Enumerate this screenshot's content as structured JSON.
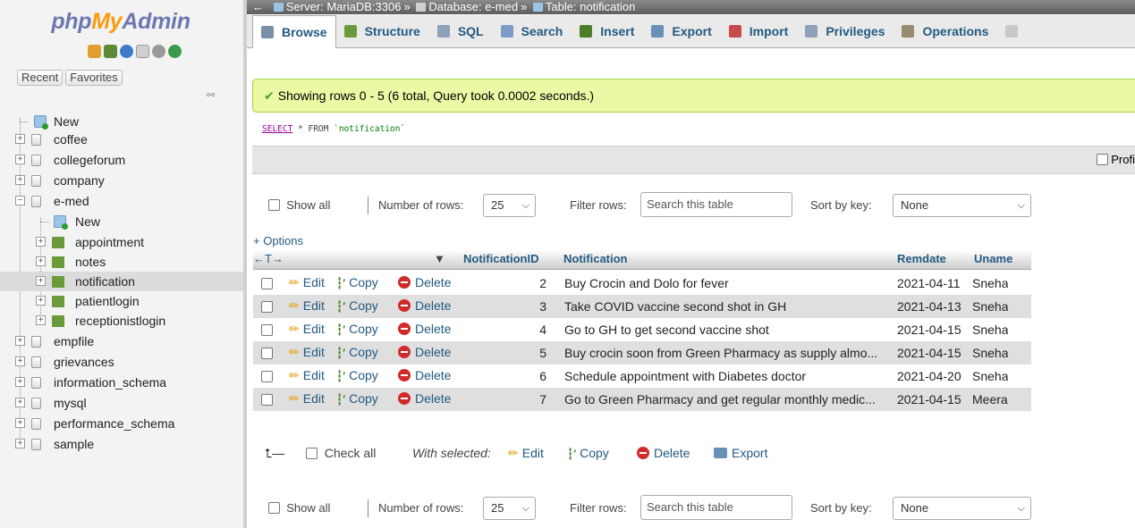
{
  "app": {
    "logo_php": "php",
    "logo_my": "My",
    "logo_admin": "Admin"
  },
  "nav": {
    "recent_tab": "Recent",
    "favorites_tab": "Favorites",
    "new_label": "New",
    "databases": [
      {
        "label": "coffee"
      },
      {
        "label": "collegeforum"
      },
      {
        "label": "company"
      },
      {
        "label": "e-med"
      },
      {
        "label": "empfile"
      },
      {
        "label": "grievances"
      },
      {
        "label": "information_schema"
      },
      {
        "label": "mysql"
      },
      {
        "label": "performance_schema"
      },
      {
        "label": "sample"
      }
    ],
    "emed_new": "New",
    "emed_tables": [
      {
        "label": "appointment"
      },
      {
        "label": "notes"
      },
      {
        "label": "notification"
      },
      {
        "label": "patientlogin"
      },
      {
        "label": "receptionistlogin"
      }
    ]
  },
  "breadcrumb": {
    "back": "←",
    "server": "Server: MariaDB:3306",
    "database": "Database: e-med",
    "table": "Table: notification",
    "sep": "»"
  },
  "tabs": [
    {
      "label": "Browse",
      "icon": "browse-icon",
      "color": "#7a8fa8"
    },
    {
      "label": "Structure",
      "icon": "structure-icon",
      "color": "#6a9a3a"
    },
    {
      "label": "SQL",
      "icon": "sql-icon",
      "color": "#8da1b8"
    },
    {
      "label": "Search",
      "icon": "search-icon",
      "color": "#7a9ac8"
    },
    {
      "label": "Insert",
      "icon": "insert-icon",
      "color": "#4b7d2b"
    },
    {
      "label": "Export",
      "icon": "export-icon",
      "color": "#6a8fb8"
    },
    {
      "label": "Import",
      "icon": "import-icon",
      "color": "#c84b4b"
    },
    {
      "label": "Privileges",
      "icon": "privileges-icon",
      "color": "#8da1b8"
    },
    {
      "label": "Operations",
      "icon": "operations-icon",
      "color": "#9a8a70"
    }
  ],
  "result": {
    "message": "Showing rows 0 - 5 (6 total, Query took 0.0002 seconds.)",
    "sql_select": "SELECT",
    "sql_rest": " * FROM ",
    "sql_table": "`notification`",
    "profiling": "Profi"
  },
  "controls": {
    "show_all": "Show all",
    "number_of_rows": "Number of rows:",
    "rows_value": "25",
    "filter_rows": "Filter rows:",
    "filter_placeholder": "Search this table",
    "sort_by_key": "Sort by key:",
    "sort_value": "None"
  },
  "table": {
    "options": "+ Options",
    "arrows": "←T→",
    "sort_arrow": "▼",
    "columns": [
      "NotificationID",
      "Notification",
      "Remdate",
      "Uname"
    ],
    "action_edit": "Edit",
    "action_copy": "Copy",
    "action_delete": "Delete",
    "rows": [
      {
        "id": "2",
        "notification": "Buy Crocin and Dolo for fever",
        "remdate": "2021-04-11",
        "uname": "Sneha"
      },
      {
        "id": "3",
        "notification": "Take COVID vaccine second shot in GH",
        "remdate": "2021-04-13",
        "uname": "Sneha"
      },
      {
        "id": "4",
        "notification": "Go to GH to get second vaccine shot",
        "remdate": "2021-04-15",
        "uname": "Sneha"
      },
      {
        "id": "5",
        "notification": "Buy crocin soon from Green Pharmacy as supply almo...",
        "remdate": "2021-04-15",
        "uname": "Sneha"
      },
      {
        "id": "6",
        "notification": "Schedule appointment with Diabetes doctor",
        "remdate": "2021-04-20",
        "uname": "Sneha"
      },
      {
        "id": "7",
        "notification": "Go to Green Pharmacy and get regular monthly medic...",
        "remdate": "2021-04-15",
        "uname": "Meera"
      }
    ]
  },
  "bulk": {
    "check_all": "Check all",
    "with_selected": "With selected:",
    "edit": "Edit",
    "copy": "Copy",
    "delete": "Delete",
    "export": "Export"
  }
}
